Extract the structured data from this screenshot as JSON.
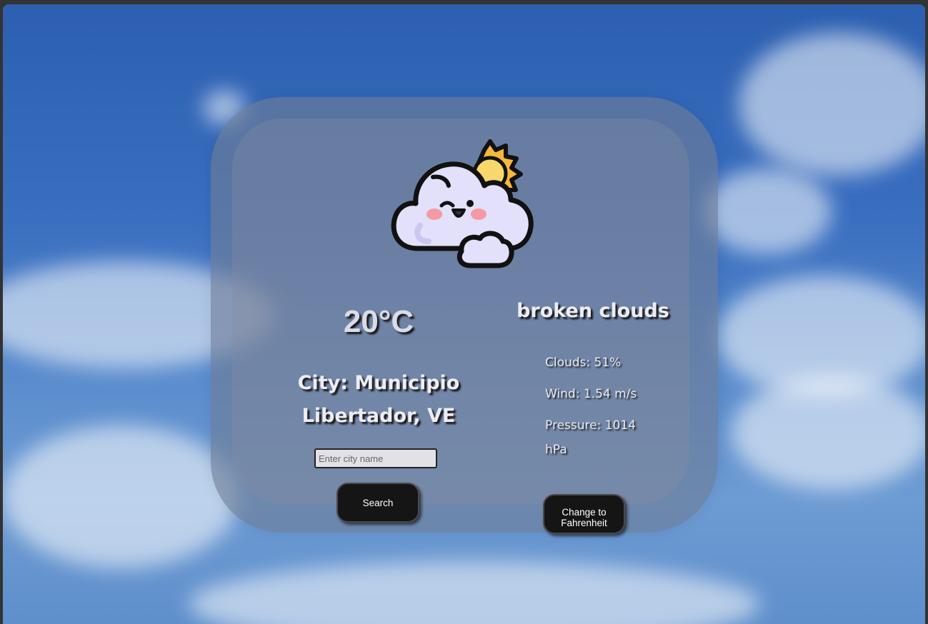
{
  "weather": {
    "temperature": "20°C",
    "city": "City: Municipio Libertador, VE",
    "description": "broken clouds",
    "clouds": "Clouds: 51%",
    "wind": "Wind: 1.54 m/s",
    "pressure": "Pressure: 1014 hPa",
    "icon": "cloud-with-sun-icon"
  },
  "search": {
    "placeholder": "Enter city name",
    "value": "",
    "button_label": "Search"
  },
  "unit_toggle": {
    "label": "Change to Fahrenheit"
  },
  "colors": {
    "button_bg": "#151515",
    "card_bg": "#6e7d96"
  }
}
